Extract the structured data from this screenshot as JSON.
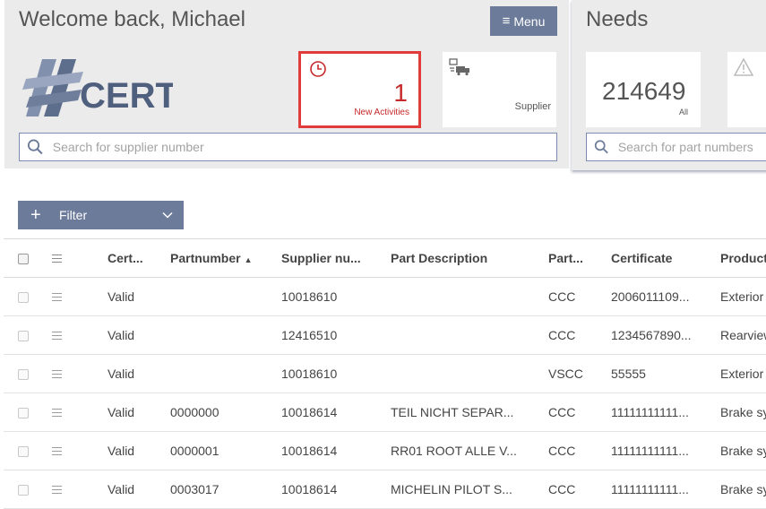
{
  "left_panel": {
    "welcome": "Welcome back, Michael",
    "menu_label": "Menu",
    "logo_text": "CERT",
    "activities": {
      "count": "1",
      "label": "New Activities"
    },
    "supplier_label": "Supplier",
    "search_placeholder": "Search for supplier number"
  },
  "right_panel": {
    "title": "Needs",
    "all": {
      "count": "214649",
      "label": "All"
    },
    "search_placeholder": "Search for part numbers"
  },
  "filter": {
    "label": "Filter"
  },
  "table": {
    "headers": [
      "Cert...",
      "Partnumber",
      "Supplier nu...",
      "Part Description",
      "Part...",
      "Certificate",
      "Product"
    ],
    "sort_indicator": "▲",
    "rows": [
      {
        "status": "Valid",
        "partnumber": "",
        "supplier": "10018610",
        "description": "",
        "part": "CCC",
        "certificate": "2006011109...",
        "product": "Exterior"
      },
      {
        "status": "Valid",
        "partnumber": "",
        "supplier": "12416510",
        "description": "",
        "part": "CCC",
        "certificate": "1234567890...",
        "product": "Rearview"
      },
      {
        "status": "Valid",
        "partnumber": "",
        "supplier": "10018610",
        "description": "",
        "part": "VSCC",
        "certificate": "55555",
        "product": "Exterior"
      },
      {
        "status": "Valid",
        "partnumber": "0000000",
        "supplier": "10018614",
        "description": "TEIL NICHT SEPAR...",
        "part": "CCC",
        "certificate": "11111111111...",
        "product": "Brake sy"
      },
      {
        "status": "Valid",
        "partnumber": "0000001",
        "supplier": "10018614",
        "description": "RR01 ROOT ALLE V...",
        "part": "CCC",
        "certificate": "11111111111...",
        "product": "Brake sy"
      },
      {
        "status": "Valid",
        "partnumber": "0003017",
        "supplier": "10018614",
        "description": "MICHELIN PILOT S...",
        "part": "CCC",
        "certificate": "11111111111...",
        "product": "Brake sy"
      }
    ]
  },
  "colors": {
    "accent": "#6b7b99",
    "highlight": "#e03c3c",
    "activity_text": "#c7292a",
    "panel_bg": "#ebebeb"
  }
}
